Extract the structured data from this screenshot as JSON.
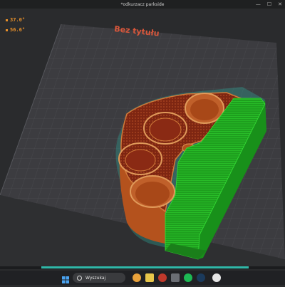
{
  "window": {
    "title": "*odkurzacz parkside"
  },
  "readouts": [
    "37.0°",
    "56.6°"
  ],
  "plate": {
    "label": "Bez tytułu"
  },
  "progress": {
    "fraction": 0.85
  },
  "taskbar": {
    "search_label": "Wyszukaj",
    "apps": [
      "windows-start-icon",
      "browser-icon",
      "file-explorer-icon",
      "mail-icon",
      "media-icon",
      "spotify-icon",
      "steam-icon",
      "slicer-app-icon"
    ]
  },
  "colors": {
    "model": "#b8561f",
    "infill": "#8a2a14",
    "support": "#22b022",
    "plate": "#3b3b3e",
    "readout": "#e8902a",
    "accent": "#2fb8a8"
  }
}
